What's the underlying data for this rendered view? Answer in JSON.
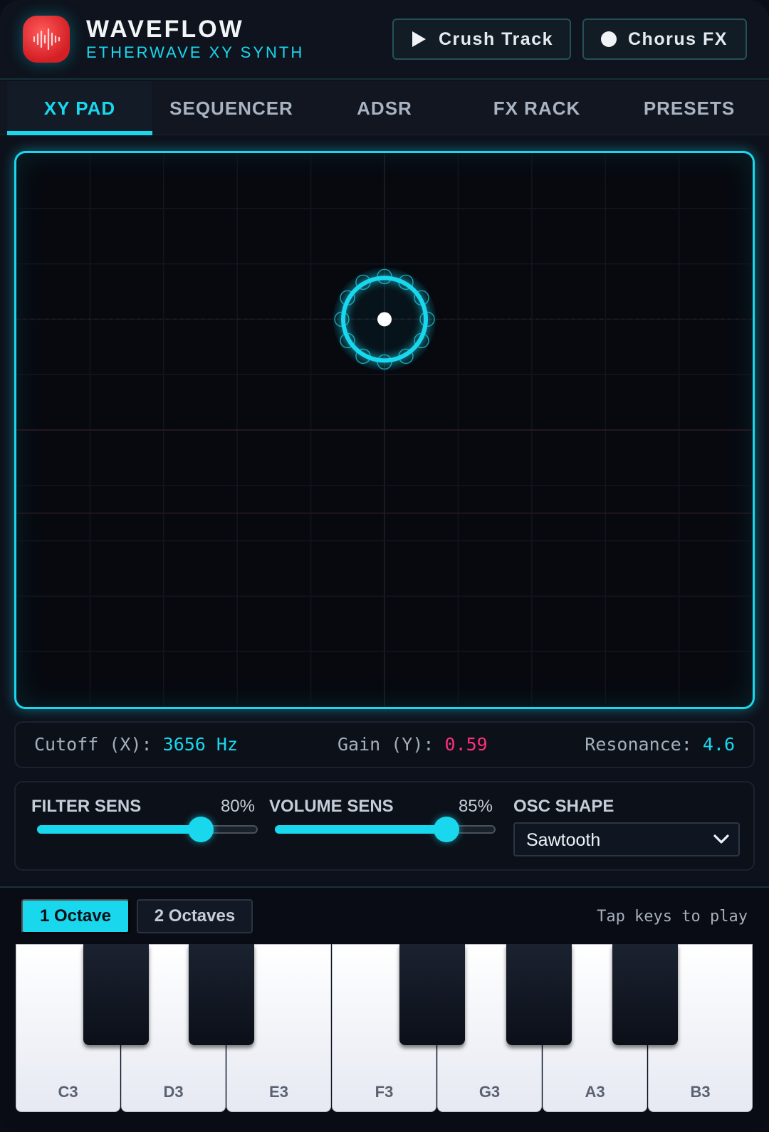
{
  "header": {
    "title": "WAVEFLOW",
    "subtitle": "ETHERWAVE XY SYNTH",
    "logo_icon": "waveform-icon",
    "crush_label": "Crush Track",
    "chorus_label": "Chorus FX",
    "accent": "#19d8ee",
    "logo_color": "#e02429"
  },
  "tabs": [
    {
      "label": "XY PAD",
      "active": true
    },
    {
      "label": "SEQUENCER",
      "active": false
    },
    {
      "label": "ADSR",
      "active": false
    },
    {
      "label": "FX RACK",
      "active": false
    },
    {
      "label": "PRESETS",
      "active": false
    }
  ],
  "xy_pad": {
    "cursor_x": 0.5,
    "cursor_y": 0.3
  },
  "readout": {
    "cutoff_label": "Cutoff (X):",
    "cutoff_value": "3656 Hz",
    "gain_label": "Gain (Y):",
    "gain_value": "0.59",
    "resonance_label": "Resonance:",
    "resonance_value": "4.6"
  },
  "controls": {
    "filter_label": "FILTER SENS",
    "filter_value": "80%",
    "filter_fraction": 0.8,
    "volume_label": "VOLUME SENS",
    "volume_value": "85%",
    "volume_fraction": 0.85,
    "osc_label": "OSC SHAPE",
    "osc_selected": "Sawtooth"
  },
  "keyboard": {
    "octave_1_label": "1 Octave",
    "octave_2_label": "2 Octaves",
    "hint": "Tap keys to play",
    "white_keys": [
      "C3",
      "D3",
      "E3",
      "F3",
      "G3",
      "A3",
      "B3"
    ]
  }
}
